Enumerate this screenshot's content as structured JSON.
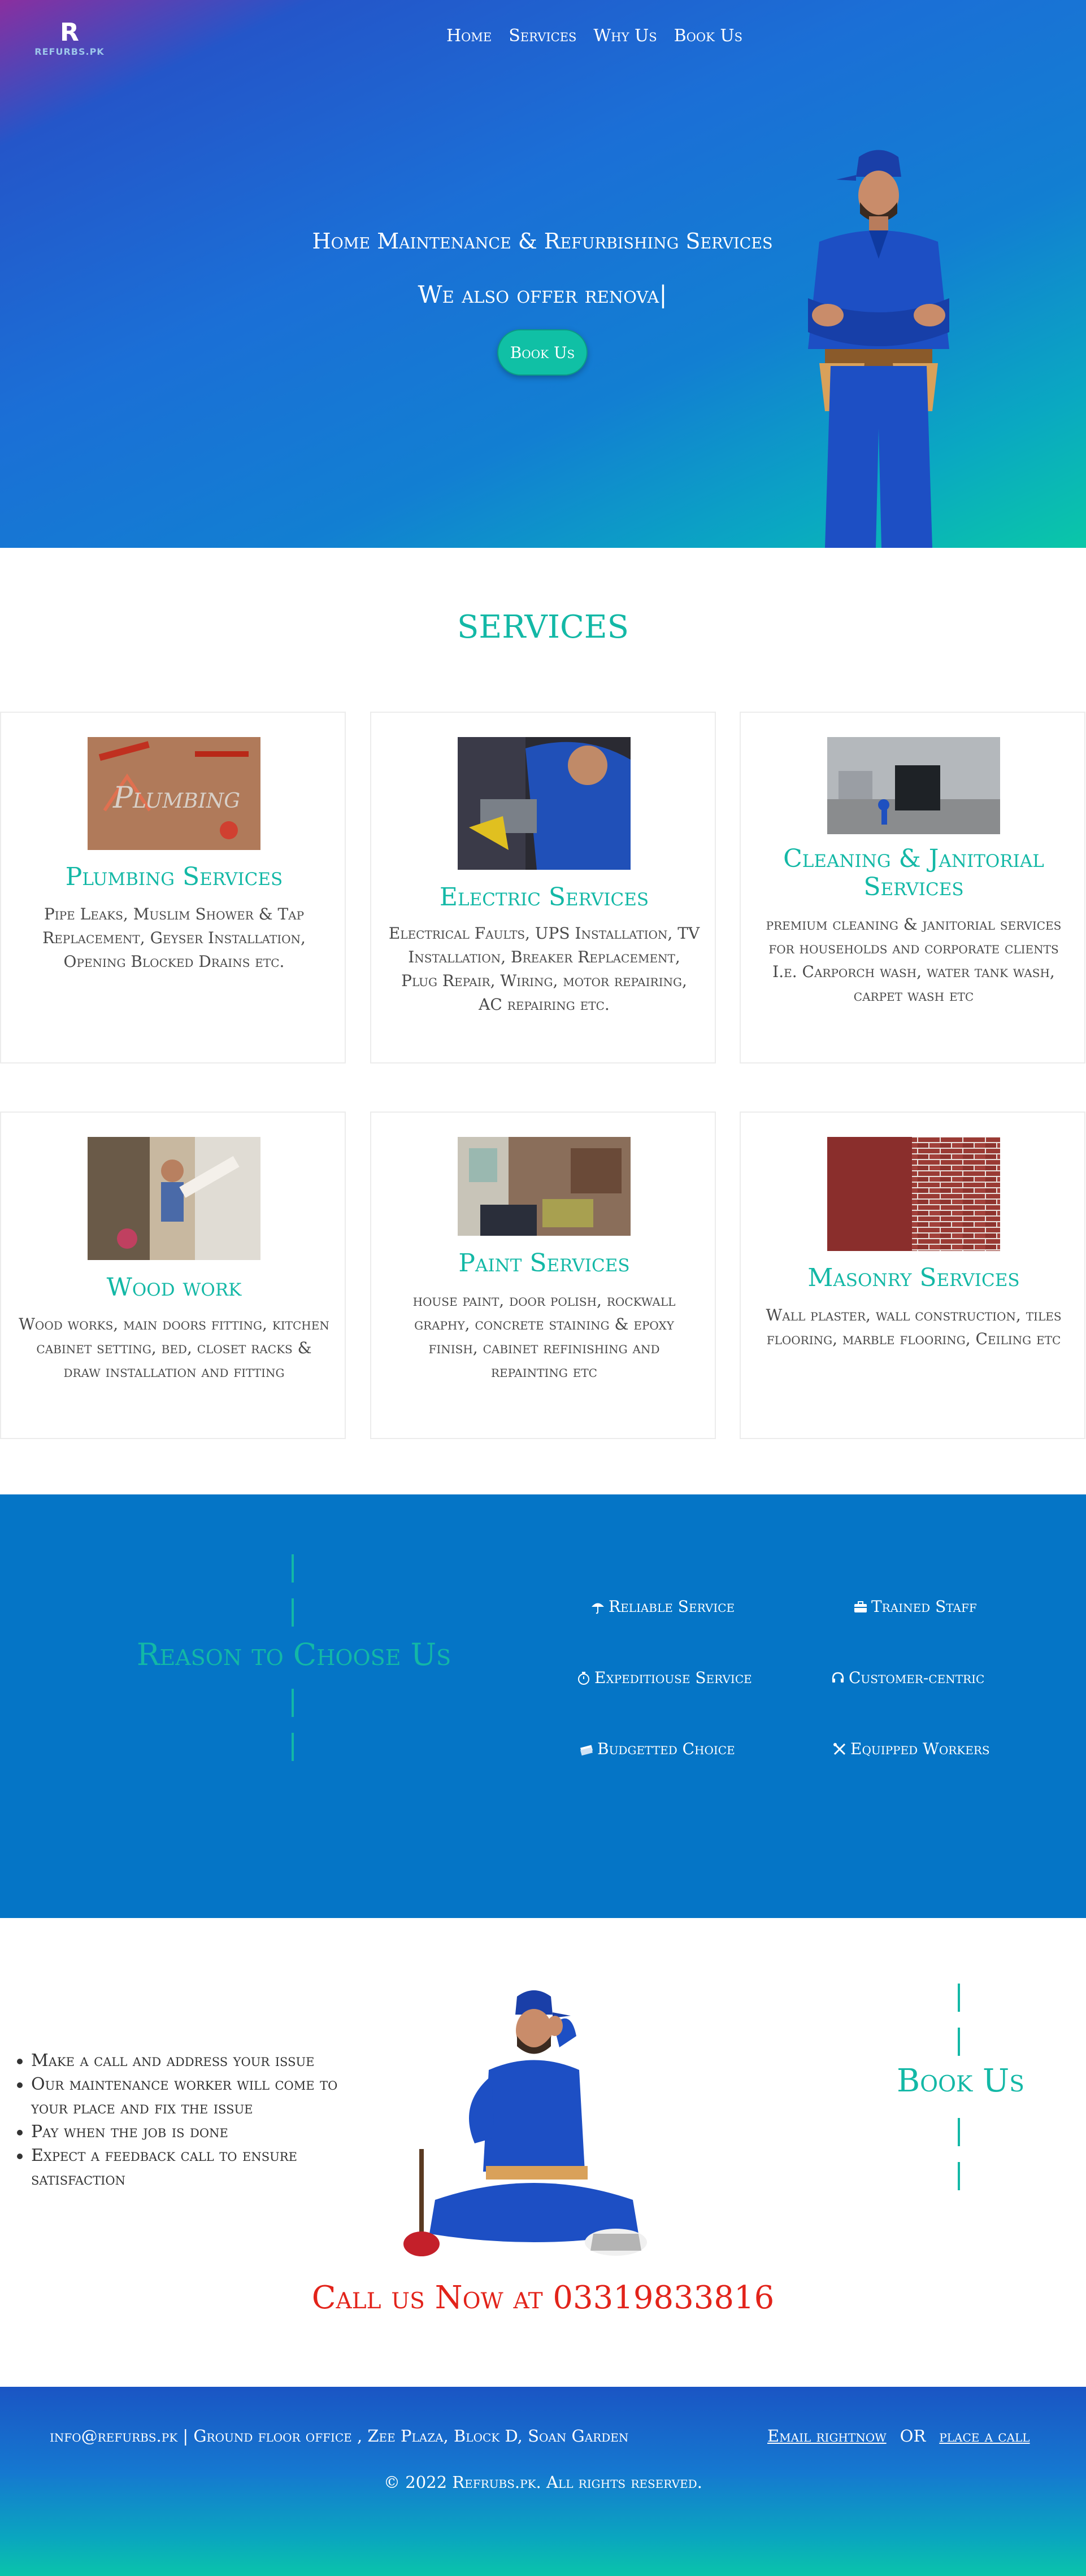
{
  "header": {
    "logo_mark": "R",
    "logo_text": "REFURBS.PK",
    "nav": [
      "Home",
      "Services",
      "Why Us",
      "Book Us"
    ]
  },
  "hero": {
    "title": "Home Maintenance & Refurbishing Services",
    "subtitle": "We also offer renova|",
    "button": "Book Us"
  },
  "services": {
    "title": "SERVICES",
    "cards": [
      {
        "title": "Plumbing Services",
        "description": "Pipe Leaks, Muslim Shower & Tap Replacement, Geyser Installation, Opening Blocked Drains etc."
      },
      {
        "title": "Electric Services",
        "description": "Electrical Faults, UPS Installation, TV Installation, Breaker Replacement, Plug Repair, Wiring, motor repairing, AC repairing etc."
      },
      {
        "title": "Cleaning & Janitorial Services",
        "description": "premium cleaning & janitorial services for households and corporate clients I.e. Carporch wash, water tank wash, carpet wash etc"
      },
      {
        "title": "Wood work",
        "description": "Wood works, main doors fitting, kitchen cabinet setting, bed, closet racks & draw installation and fitting"
      },
      {
        "title": "Paint Services",
        "description": "house paint, door polish, rockwall graphy, concrete staining & epoxy finish, cabinet refinishing and repainting etc"
      },
      {
        "title": "Masonry Services",
        "description": "Wall plaster, wall construction, tiles flooring, marble flooring, Ceiling etc"
      }
    ]
  },
  "why": {
    "title": "Reason to Choose Us",
    "items": [
      "Reliable Service",
      "Trained Staff",
      "Expeditiouse Service",
      "Customer-centric",
      "Budgetted Choice",
      "Equipped Workers"
    ]
  },
  "book": {
    "steps": [
      "Make a call and address your issue",
      "Our maintenance worker will come to your place and fix the issue",
      "Pay when the job is done",
      "Expect a feedback call to ensure satisfaction"
    ],
    "title": "Book Us",
    "call": "Call us Now at 03319833816"
  },
  "footer": {
    "address": "info@refurbs.pk | Ground floor office , Zee Plaza, Block D, Soan Garden",
    "email_link": "Email rightnow",
    "or": "OR",
    "call_link": "place a call",
    "copyright": "© 2022 Refrubs.pk. All rights reserved."
  },
  "colors": {
    "accent": "#13b8a6",
    "why_bg": "#0575c6",
    "call": "#e2231a"
  }
}
